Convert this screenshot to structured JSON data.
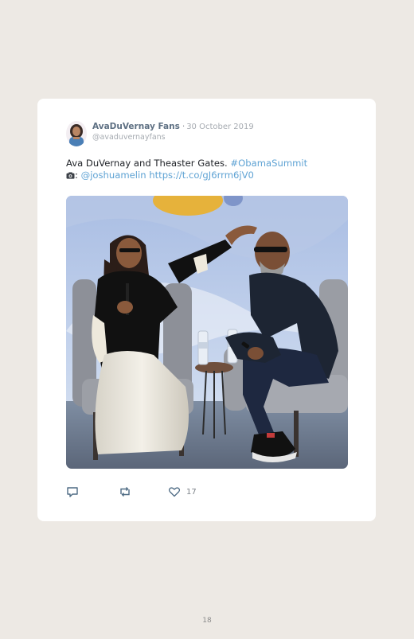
{
  "tweet": {
    "author_name": "AvaDuVernay Fans",
    "separator": "·",
    "date": "30 October 2019",
    "handle": "@avaduvernayfans",
    "text_main": "Ava DuVernay and Theaster Gates. ",
    "hashtag": "#ObamaSummit",
    "camera_suffix": ": ",
    "mention": "@joshuamelin",
    "url": "https://t.co/gJ6rrm6jV0",
    "like_count": "17"
  },
  "icons": {
    "reply": "reply-icon",
    "retweet": "retweet-icon",
    "like": "heart-icon",
    "camera": "camera-icon"
  },
  "colors": {
    "page_background": "#ede9e4",
    "card_background": "#ffffff",
    "link": "#5fa3d4",
    "author_name": "#5e7083"
  },
  "page": {
    "number": "18"
  }
}
